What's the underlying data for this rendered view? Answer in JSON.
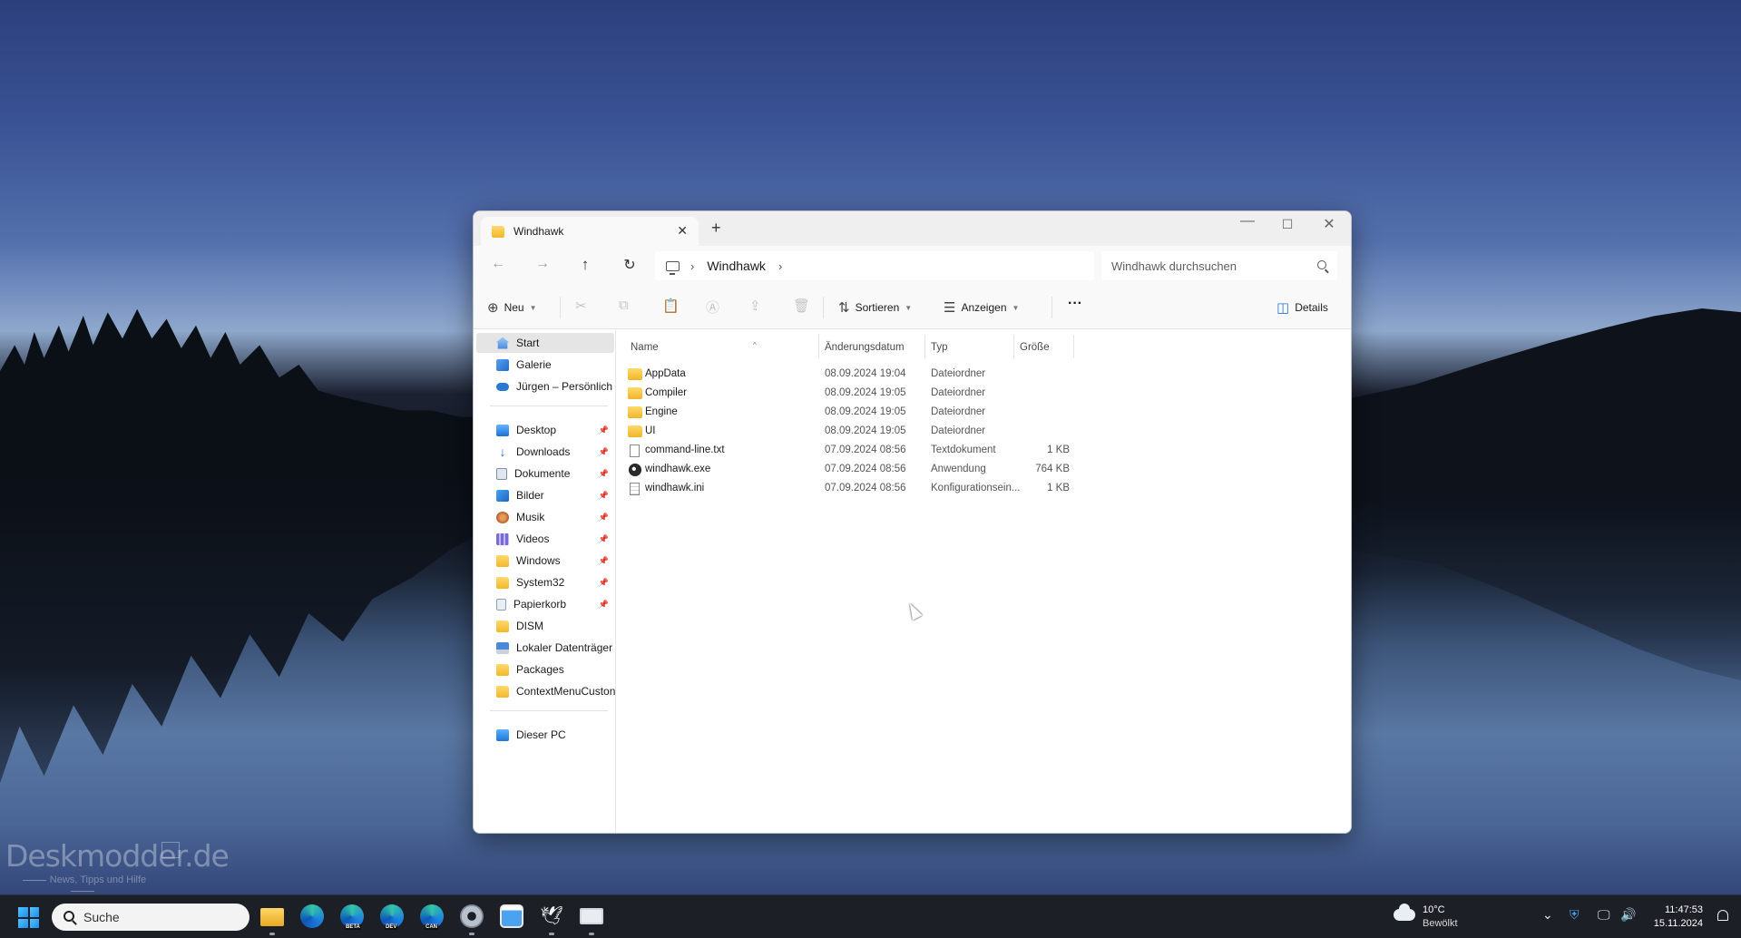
{
  "watermark": {
    "brand": "Deskmodder.de",
    "tagline": "News, Tipps und Hilfe"
  },
  "window": {
    "tab_title": "Windhawk",
    "tab_close": "✕",
    "new_tab": "+",
    "controls": {
      "minimize": "—",
      "maximize": "☐",
      "close": "✕"
    }
  },
  "navigation": {
    "back": "←",
    "forward": "→",
    "up": "↑",
    "refresh": "↻",
    "breadcrumb": [
      "Windhawk"
    ],
    "breadcrumb_separator": "›",
    "search_placeholder": "Windhawk durchsuchen"
  },
  "toolbar": {
    "new_label": "Neu",
    "sort_label": "Sortieren",
    "view_label": "Anzeigen",
    "more_label": "···",
    "details_label": "Details"
  },
  "sidebar": {
    "quick": [
      {
        "label": "Start",
        "icon": "home-icon",
        "selected": true
      },
      {
        "label": "Galerie",
        "icon": "gallery-icon"
      },
      {
        "label": "Jürgen – Persönlich",
        "icon": "onedrive-icon"
      }
    ],
    "pinned": [
      {
        "label": "Desktop",
        "icon": "desktop-icon"
      },
      {
        "label": "Downloads",
        "icon": "download-icon"
      },
      {
        "label": "Dokumente",
        "icon": "documents-icon"
      },
      {
        "label": "Bilder",
        "icon": "pictures-icon"
      },
      {
        "label": "Musik",
        "icon": "music-icon"
      },
      {
        "label": "Videos",
        "icon": "videos-icon"
      },
      {
        "label": "Windows",
        "icon": "folder-icon"
      },
      {
        "label": "System32",
        "icon": "folder-icon"
      },
      {
        "label": "Papierkorb",
        "icon": "recycle-bin-icon"
      }
    ],
    "unpinned": [
      {
        "label": "DISM",
        "icon": "folder-icon"
      },
      {
        "label": "Lokaler Datenträger (",
        "icon": "drive-icon"
      },
      {
        "label": "Packages",
        "icon": "folder-icon"
      },
      {
        "label": "ContextMenuCuston",
        "icon": "folder-icon"
      }
    ],
    "this_pc": {
      "label": "Dieser PC",
      "icon": "pc-icon"
    },
    "pin_glyph": "📌"
  },
  "columns": {
    "name": "Name",
    "date": "Änderungsdatum",
    "type": "Typ",
    "size": "Größe"
  },
  "files": [
    {
      "name": "AppData",
      "date": "08.09.2024 19:04",
      "type": "Dateiordner",
      "size": "",
      "icon": "folder"
    },
    {
      "name": "Compiler",
      "date": "08.09.2024 19:05",
      "type": "Dateiordner",
      "size": "",
      "icon": "folder"
    },
    {
      "name": "Engine",
      "date": "08.09.2024 19:05",
      "type": "Dateiordner",
      "size": "",
      "icon": "folder"
    },
    {
      "name": "UI",
      "date": "08.09.2024 19:05",
      "type": "Dateiordner",
      "size": "",
      "icon": "folder"
    },
    {
      "name": "command-line.txt",
      "date": "07.09.2024 08:56",
      "type": "Textdokument",
      "size": "1 KB",
      "icon": "txt"
    },
    {
      "name": "windhawk.exe",
      "date": "07.09.2024 08:56",
      "type": "Anwendung",
      "size": "764 KB",
      "icon": "exe"
    },
    {
      "name": "windhawk.ini",
      "date": "07.09.2024 08:56",
      "type": "Konfigurationsein...",
      "size": "1 KB",
      "icon": "ini"
    }
  ],
  "taskbar": {
    "search_label": "Suche",
    "weather_temp": "10°C",
    "weather_desc": "Bewölkt",
    "time": "11:47:53",
    "date": "15.11.2024",
    "tray_chevron": "⌄",
    "badges": {
      "beta": "BETA",
      "dev": "DEV",
      "can": "CAN"
    }
  }
}
